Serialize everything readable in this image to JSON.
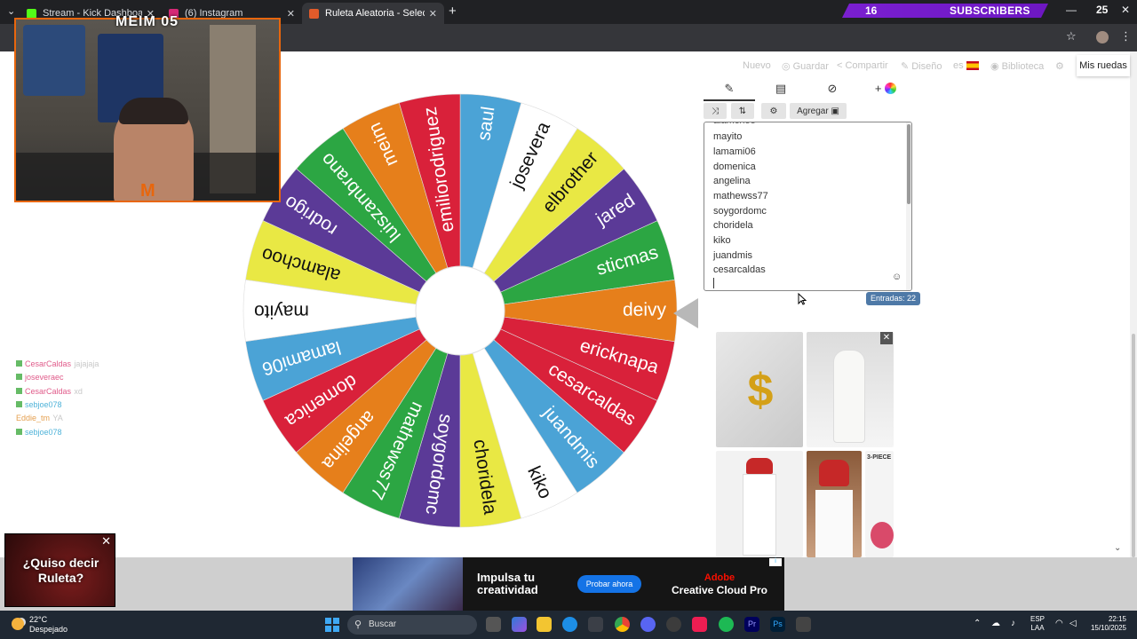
{
  "browser": {
    "tabs": [
      {
        "title": "Stream - Kick Dashboard",
        "color": "#53fc18"
      },
      {
        "title": "(6) Instagram",
        "color": "#d62976"
      },
      {
        "title": "Ruleta Aleatoria - Selector Pers",
        "color": "#e05b2a",
        "active": true
      }
    ],
    "new_tab": "+"
  },
  "overlay": {
    "subs_count": "16",
    "subs_label": "SUBSCRIBERS",
    "counter": "25",
    "cam_title": "MEIM 05",
    "cam_logo": "M"
  },
  "menu": {
    "new": "Nuevo",
    "save": "Guardar",
    "share": "Compartir",
    "design": "Diseño",
    "language": "es",
    "library": "Biblioteca",
    "my_wheels": "Mis ruedas"
  },
  "editor": {
    "add_label": "Agregar",
    "entries": [
      "mayito",
      "lamami06",
      "domenica",
      "angelina",
      "mathewss77",
      "soygordomc",
      "choridela",
      "kiko",
      "juandmis",
      "cesarcaldas"
    ],
    "entries_count": "Entradas: 22"
  },
  "wheel": {
    "segments": [
      {
        "name": "saul",
        "color": "#4ba3d6"
      },
      {
        "name": "josevera",
        "color": "#ffffff"
      },
      {
        "name": "elbrother",
        "color": "#e9e844"
      },
      {
        "name": "jared",
        "color": "#5b3a97"
      },
      {
        "name": "sticmas",
        "color": "#2ca643"
      },
      {
        "name": "deivy",
        "color": "#e67f1b"
      },
      {
        "name": "ericknapa",
        "color": "#d9213a"
      },
      {
        "name": "cesarcaldas",
        "color": "#d9213a"
      },
      {
        "name": "juandmis",
        "color": "#4ba3d6"
      },
      {
        "name": "kiko",
        "color": "#ffffff"
      },
      {
        "name": "choridela",
        "color": "#e9e844"
      },
      {
        "name": "soygordomc",
        "color": "#5b3a97"
      },
      {
        "name": "mathewss77",
        "color": "#2ca643"
      },
      {
        "name": "angelina",
        "color": "#e67f1b"
      },
      {
        "name": "domenica",
        "color": "#d9213a"
      },
      {
        "name": "lamami06",
        "color": "#4ba3d6"
      },
      {
        "name": "mayito",
        "color": "#ffffff"
      },
      {
        "name": "alamchoo",
        "color": "#e9e844"
      },
      {
        "name": "rodrigo",
        "color": "#5b3a97"
      },
      {
        "name": "luiszambrano",
        "color": "#2ca643"
      },
      {
        "name": "meim",
        "color": "#e67f1b"
      },
      {
        "name": "emiliorodriguez",
        "color": "#d9213a"
      }
    ]
  },
  "chat": [
    {
      "user": "CesarCaldas",
      "text": "jajajaja",
      "color": "#e05b8a"
    },
    {
      "user": "joseveraec",
      "text": "",
      "color": "#e05b8a"
    },
    {
      "user": "CesarCaldas",
      "text": "xd",
      "color": "#e05b8a"
    },
    {
      "user": "sebjoe078",
      "text": "",
      "color": "#4fb3d9"
    },
    {
      "user": "Eddie_tm",
      "text": "YA",
      "color": "#e5a050"
    },
    {
      "user": "sebjoe078",
      "text": "",
      "color": "#4fb3d9"
    }
  ],
  "ads": {
    "roulette": "¿Quiso decir Ruleta?",
    "banner_headline": "Impulsa tu creatividad",
    "banner_button": "Probar ahora",
    "banner_brand_top": "Adobe",
    "banner_brand": "Creative Cloud Pro",
    "three_piece": "3-PIECE",
    "close": "✕"
  },
  "taskbar": {
    "temperature": "22°C",
    "weather": "Despejado",
    "search": "Buscar",
    "lang1": "ESP",
    "lang2": "LAA",
    "time": "22:15",
    "date": "15/10/2025"
  }
}
